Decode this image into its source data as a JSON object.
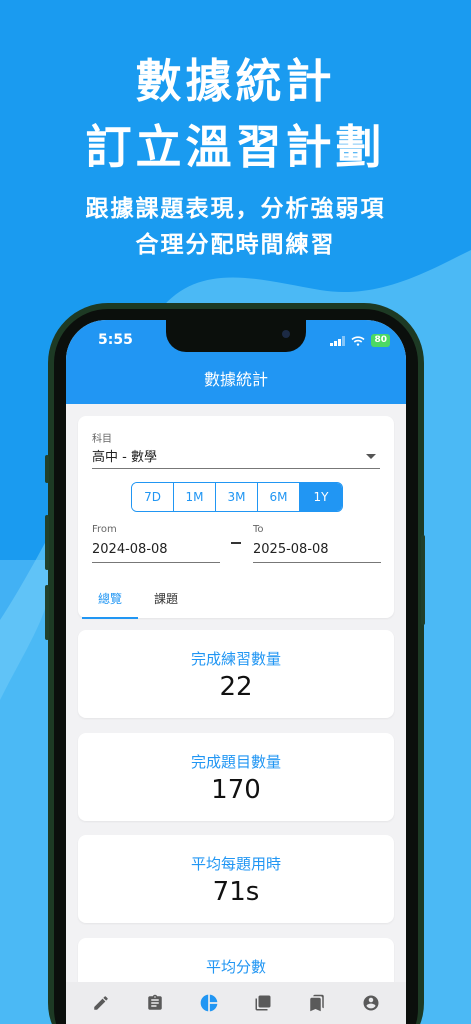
{
  "promo": {
    "title_line1": "數據統計",
    "title_line2": "訂立溫習計劃",
    "subtitle_line1": "跟據課題表現，分析強弱項",
    "subtitle_line2": "合理分配時間練習"
  },
  "status_bar": {
    "time": "5:55",
    "battery": "80"
  },
  "app_bar": {
    "title": "數據統計"
  },
  "filters": {
    "subject_label": "科目",
    "subject_value": "高中 - 數學",
    "ranges": [
      "7D",
      "1M",
      "3M",
      "6M",
      "1Y"
    ],
    "selected_range": "1Y",
    "from_label": "From",
    "from_value": "2024-08-08",
    "to_label": "To",
    "to_value": "2025-08-08"
  },
  "tabs": [
    {
      "label": "總覽",
      "active": true
    },
    {
      "label": "課題",
      "active": false
    }
  ],
  "stats": [
    {
      "label": "完成練習數量",
      "value": "22"
    },
    {
      "label": "完成題目數量",
      "value": "170"
    },
    {
      "label": "平均每題用時",
      "value": "71s"
    },
    {
      "label": "平均分數",
      "value": ""
    }
  ],
  "bottom_nav": [
    {
      "icon": "pencil-icon",
      "active": false
    },
    {
      "icon": "clipboard-icon",
      "active": false
    },
    {
      "icon": "pie-chart-icon",
      "active": true
    },
    {
      "icon": "library-icon",
      "active": false
    },
    {
      "icon": "bookmarks-icon",
      "active": false
    },
    {
      "icon": "account-icon",
      "active": false
    }
  ],
  "colors": {
    "background": "#1a9bf0",
    "primary": "#2196f3",
    "wave": "#5cc3f7"
  }
}
